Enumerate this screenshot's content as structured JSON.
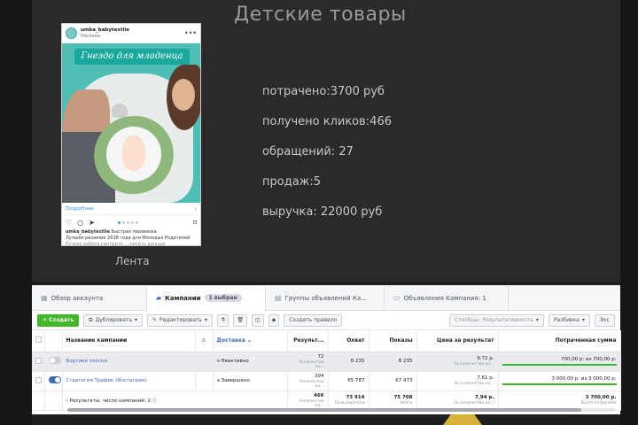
{
  "slide": {
    "title": "Детские товары",
    "stats": [
      "потрачено:3700 руб",
      "получено кликов:466",
      "обращений: 27",
      "продаж:5",
      "выручка: 22000 руб"
    ],
    "feed_label": "Лента"
  },
  "post": {
    "username": "umka_babytextile",
    "sponsored": "Реклама",
    "banner_text": "Гнездо для младенца",
    "cta": "Подробнее",
    "caption_user": "umka_babytextile",
    "caption_lines": [
      "Быстрая перевязка",
      "Лучшее решение 2018 года для Молодых Родителей",
      "Ручная работа смотрите ... читать дальше"
    ],
    "carousel_total": 5,
    "carousel_active": 1
  },
  "ads_manager": {
    "tabs": [
      {
        "label": "Обзор аккаунта",
        "icon": "account-overview-icon"
      },
      {
        "label": "Кампании",
        "icon": "campaigns-icon",
        "badge": "1 выбран"
      },
      {
        "label": "Группы объявлений Ка...",
        "icon": "ad-sets-icon"
      },
      {
        "label": "Объявления Кампания: 1",
        "icon": "ads-icon"
      }
    ],
    "toolbar": {
      "create": "+ Создать",
      "duplicate": "Дублировать",
      "edit": "Редактировать",
      "create_rule": "Создать правило",
      "columns": "Столбцы: Результативность",
      "breakdown": "Разбивка",
      "export": "Экс"
    },
    "columns": [
      "Название кампании",
      "Доставка",
      "Результ...",
      "Охват",
      "Показы",
      "Цена за результат",
      "Потраченная сумма"
    ],
    "rows": [
      {
        "name": "Бортики плоски",
        "active": false,
        "delivery": "Неактивно",
        "results": "72",
        "results_sub": "Количество ко...",
        "reach": "8 235",
        "impressions": "8 235",
        "cpr": "9,72 р.",
        "cpr_sub": "За количество ко...",
        "spent": "700,00 р. из 700,00 р.",
        "spent_fraction": 1.0
      },
      {
        "name": "Стратегия Трафик (Инстаграм)",
        "active": true,
        "delivery": "Завершено",
        "results": "394",
        "results_sub": "Количество ко...",
        "reach": "65 787",
        "impressions": "67 473",
        "cpr": "7,61 р.",
        "cpr_sub": "За количество ко...",
        "spent": "3 000,00 р. из 3 000,00 р.",
        "spent_fraction": 1.0
      }
    ],
    "totals": {
      "label": "Результаты, число кампаний: 2",
      "results": "466",
      "results_sub": "Количество ко...",
      "reach": "73 914",
      "reach_sub": "Пользователи",
      "impressions": "75 708",
      "impressions_sub": "Всего",
      "cpr": "7,94 р.",
      "cpr_sub": "За количество ко...",
      "spent": "3 700,00 р.",
      "spent_sub": "Всего потрачено"
    },
    "colors": {
      "accent": "#4267b2",
      "create_green": "#42b72a"
    }
  }
}
